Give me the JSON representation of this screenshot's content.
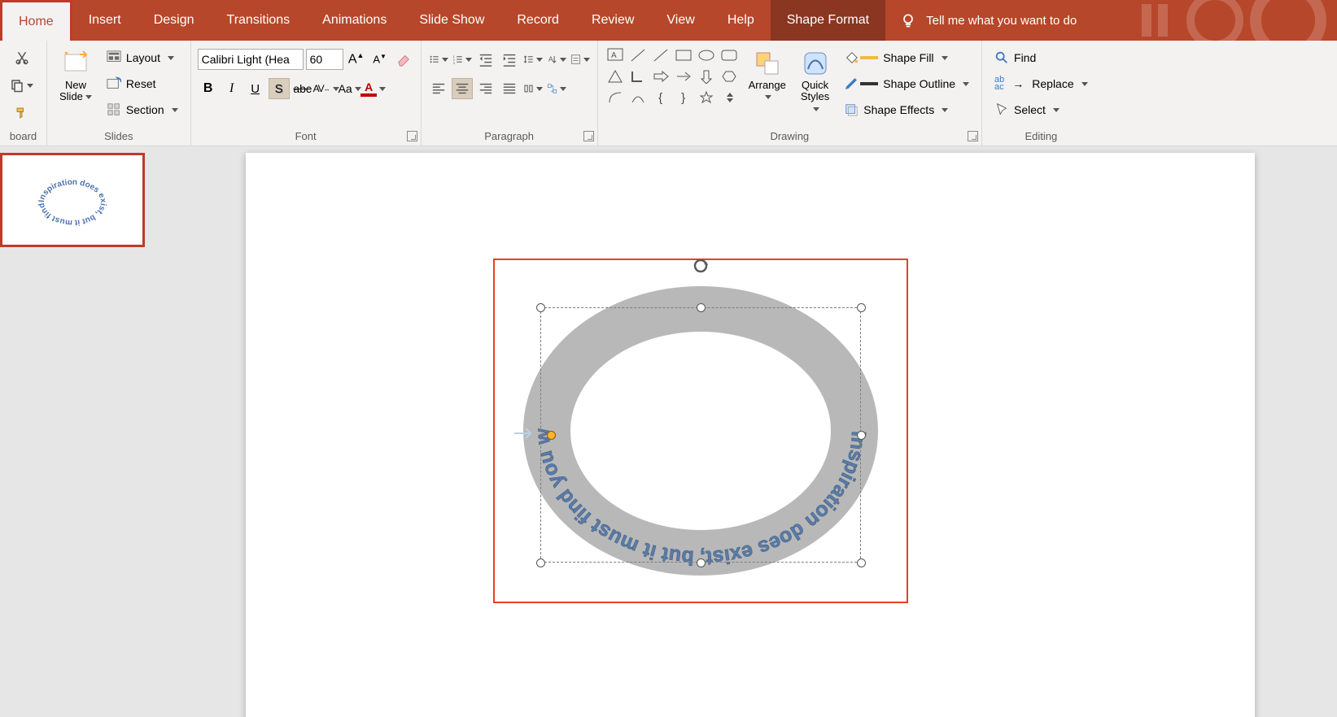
{
  "tabs": {
    "home": "Home",
    "insert": "Insert",
    "design": "Design",
    "transitions": "Transitions",
    "animations": "Animations",
    "slideshow": "Slide Show",
    "record": "Record",
    "review": "Review",
    "view": "View",
    "help": "Help",
    "context": "Shape Format",
    "tellme": "Tell me what you want to do"
  },
  "clipboard": {
    "label": "board"
  },
  "slides": {
    "label": "Slides",
    "new": "New\nSlide",
    "layout": "Layout",
    "reset": "Reset",
    "section": "Section"
  },
  "font": {
    "label": "Font",
    "name": "Calibri Light (Hea",
    "size": "60"
  },
  "paragraph": {
    "label": "Paragraph"
  },
  "drawing": {
    "label": "Drawing",
    "arrange": "Arrange",
    "quick": "Quick\nStyles",
    "fill": "Shape Fill",
    "outline": "Shape Outline",
    "effects": "Shape Effects"
  },
  "editing": {
    "label": "Editing",
    "find": "Find",
    "replace": "Replace",
    "select": "Select"
  },
  "shape_text": "Inspiration does exist, but it must find you working"
}
